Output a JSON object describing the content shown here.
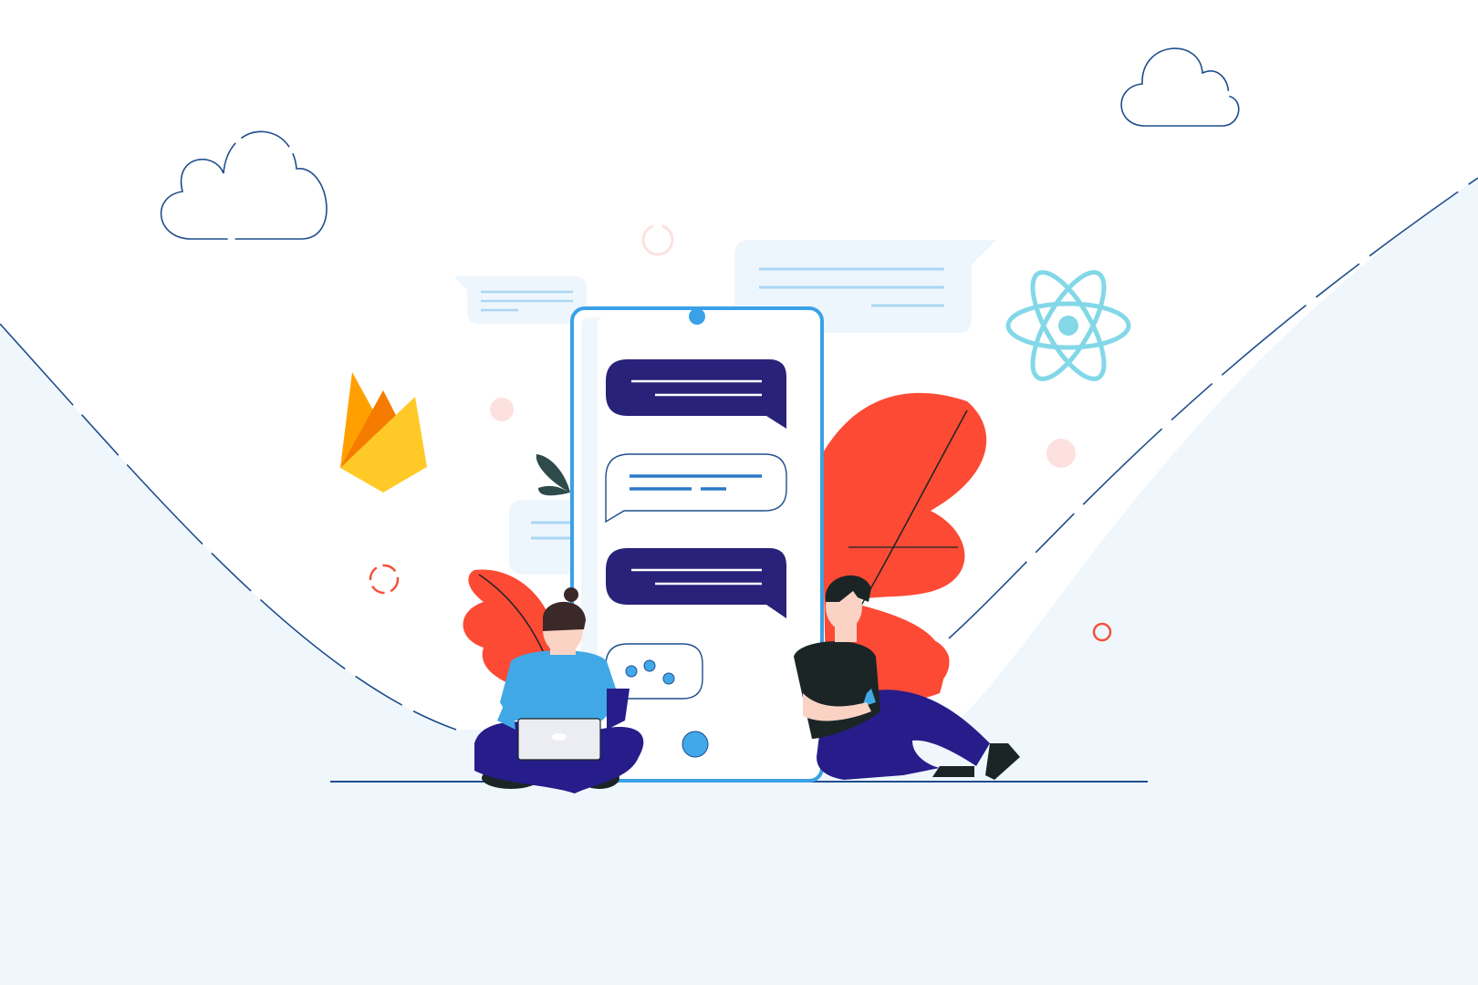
{
  "scene": {
    "colors": {
      "background": "#ffffff",
      "hill_fill": "#f0f7fc",
      "outline": "#1f4e8c",
      "phone_frame": "#3aa1e6",
      "phone_screen": "#ffffff",
      "bubble_dark": "#28227a",
      "bubble_accent": "#2b79c8",
      "dot_blue": "#41a8ea",
      "leaf_red": "#fc4a34",
      "leaf_dark": "#2f4a4b",
      "react_cyan": "#83d8e8",
      "firebase_yellow": "#ffca28",
      "firebase_orange": "#ffa000",
      "firebase_deep": "#f57c00",
      "pink_dot": "#fde1de",
      "ring_red": "#f2533a",
      "faint_bubble": "#eef6fd",
      "faint_line": "#a9d7f3",
      "skin": "#fbd3c5",
      "hair": "#3b2929",
      "shirt_blue": "#41a8e6",
      "pants_navy": "#261c8a",
      "shirt_black": "#1b2526",
      "shoe_dark": "#1b2526",
      "laptop": "#ececf3"
    },
    "icons": [
      "cloud-icon",
      "react-logo-icon",
      "firebase-logo-icon",
      "chat-bubble-icon",
      "leaf-icon"
    ],
    "chat_messages": [
      {
        "kind": "incoming-dark",
        "lines": 2
      },
      {
        "kind": "outgoing-outline",
        "lines": 2
      },
      {
        "kind": "incoming-dark",
        "lines": 2
      },
      {
        "kind": "typing-indicator",
        "dots": 3
      }
    ]
  }
}
